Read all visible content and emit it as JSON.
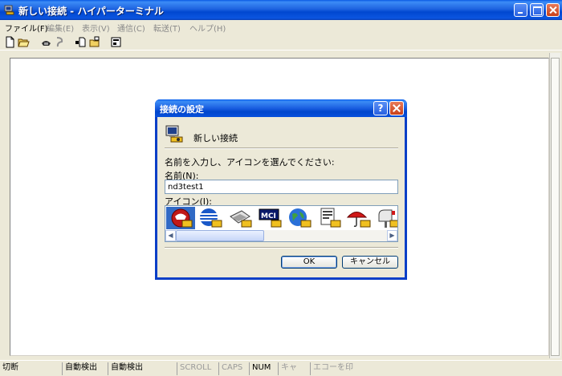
{
  "window": {
    "title": "新しい接続 - ハイパーターミナル"
  },
  "menu": {
    "items": [
      "ファイル(F)",
      "編集(E)",
      "表示(V)",
      "通信(C)",
      "転送(T)",
      "ヘルプ(H)"
    ]
  },
  "toolbar": {
    "icons": [
      "new-icon",
      "open-icon",
      "connect-icon",
      "disconnect-icon",
      "send-icon",
      "receive-icon",
      "properties-icon"
    ]
  },
  "dialog": {
    "title": "接続の設定",
    "connection_label": "新しい接続",
    "instruction": "名前を入力し、アイコンを選んでください:",
    "name_label": "名前(N):",
    "name_value": "nd3test1",
    "icon_label": "アイコン(I):",
    "icons": [
      "phone-red-icon",
      "globe-stripes-icon",
      "fax-icon",
      "mci-icon",
      "globe-blue-icon",
      "document-icon",
      "umbrella-icon",
      "mailbox-icon"
    ],
    "ok_label": "OK",
    "cancel_label": "キャンセル"
  },
  "status": {
    "cells": [
      "切断",
      "自動検出",
      "自動検出",
      "SCROLL",
      "CAPS",
      "NUM",
      "キャ",
      "エコーを印"
    ]
  },
  "colors": {
    "titlebar": "#0a5ae4",
    "selection": "#316ac5",
    "face": "#ece9d8"
  }
}
